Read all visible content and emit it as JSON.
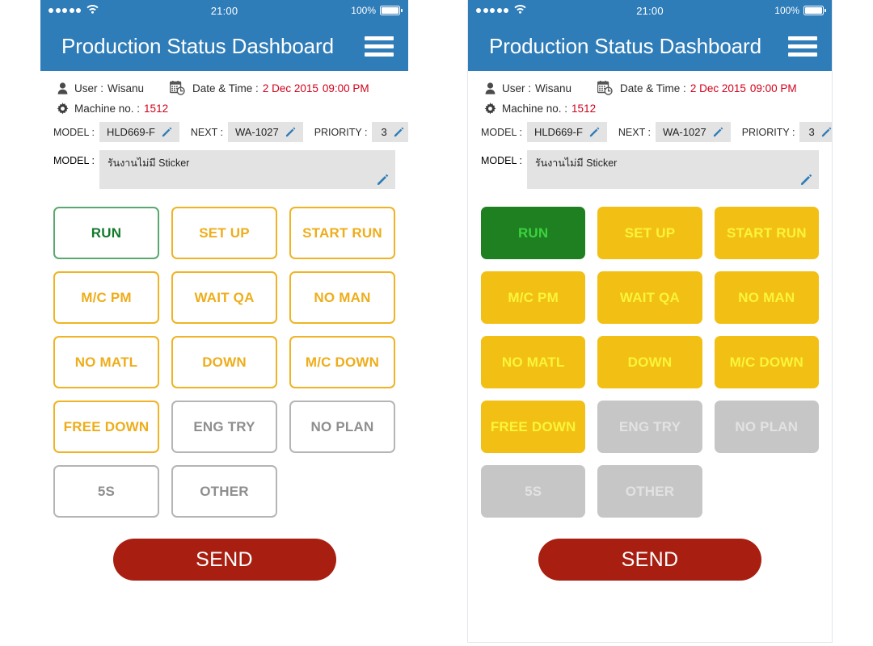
{
  "app": {
    "title": "Production Status Dashboard",
    "menu_icon": "hamburger-menu-icon",
    "brand_color": "#2e7cb8"
  },
  "status_bar": {
    "signal_dots": 5,
    "wifi_icon": "wifi-icon",
    "time": "21:00",
    "battery_percent": "100%",
    "battery_icon": "battery-full-icon"
  },
  "info": {
    "user_icon": "user-icon",
    "user_label": "User :",
    "user_value": "Wisanu",
    "calendar_icon": "calendar-clock-icon",
    "datetime_label": "Date & Time :",
    "date_value": "2 Dec 2015",
    "time_value": "09:00 PM",
    "gear_icon": "gear-icon",
    "machine_label": "Machine no. :",
    "machine_value": "1512"
  },
  "fields": {
    "model_label": "MODEL :",
    "model_value": "HLD669-F",
    "next_label": "NEXT :",
    "next_value": "WA-1027",
    "priority_label": "PRIORITY :",
    "priority_value": "3",
    "edit_icon": "pencil-edit-icon",
    "note_label": "MODEL :",
    "note_value": "รันงานไม่มี Sticker"
  },
  "status_buttons": [
    {
      "label": "RUN",
      "left_state": "outline-green",
      "right_state": "filled-green"
    },
    {
      "label": "SET UP",
      "left_state": "outline-amber",
      "right_state": "filled-amber"
    },
    {
      "label": "START RUN",
      "left_state": "outline-amber",
      "right_state": "filled-amber"
    },
    {
      "label": "M/C PM",
      "left_state": "outline-amber",
      "right_state": "filled-amber"
    },
    {
      "label": "WAIT QA",
      "left_state": "outline-amber",
      "right_state": "filled-amber"
    },
    {
      "label": "NO MAN",
      "left_state": "outline-amber",
      "right_state": "filled-amber"
    },
    {
      "label": "NO MATL",
      "left_state": "outline-amber",
      "right_state": "filled-amber"
    },
    {
      "label": "DOWN",
      "left_state": "outline-amber",
      "right_state": "filled-amber"
    },
    {
      "label": "M/C DOWN",
      "left_state": "outline-amber",
      "right_state": "filled-amber"
    },
    {
      "label": "FREE DOWN",
      "left_state": "outline-amber",
      "right_state": "filled-amber"
    },
    {
      "label": "ENG TRY",
      "left_state": "outline-gray",
      "right_state": "filled-gray"
    },
    {
      "label": "NO PLAN",
      "left_state": "outline-gray",
      "right_state": "filled-gray"
    },
    {
      "label": "5S",
      "left_state": "outline-gray",
      "right_state": "filled-gray"
    },
    {
      "label": "OTHER",
      "left_state": "outline-gray",
      "right_state": "filled-gray"
    }
  ],
  "send": {
    "label": "SEND",
    "color": "#a81f11"
  },
  "colors": {
    "header_blue": "#2e7cb8",
    "amber_outline": "#f0b323",
    "amber_fill": "#f2c014",
    "amber_fill_text": "#fbf43c",
    "green_outline": "#5aa86f",
    "green_text": "#137a2b",
    "green_fill": "#1e8021",
    "green_fill_text": "#3cd23f",
    "gray_outline": "#b5b5b5",
    "gray_fill": "#c6c6c6",
    "red_value": "#d0021b",
    "field_bg": "#e3e3e3"
  }
}
